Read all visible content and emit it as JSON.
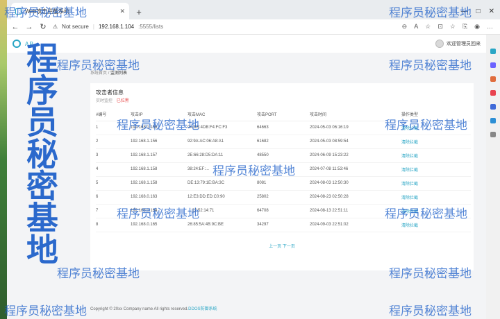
{
  "browser": {
    "tab_title": "Web攻击拦截系统",
    "new_tab": "+",
    "tab_close": "✕",
    "window_controls": [
      "—",
      "□",
      "✕"
    ],
    "nav": {
      "back": "←",
      "forward": "→",
      "reload": "↻"
    },
    "url": {
      "warning": "⚠",
      "not_secure": "Not secure",
      "host": "192.168.1.104",
      "path": ":5555/lists"
    },
    "addr_icons": [
      "⊖",
      "A",
      "☆",
      "⊡",
      "☆",
      "⎘",
      "◉",
      "…"
    ]
  },
  "app": {
    "logo_text": "AP",
    "welcome_text": "欢迎管理员回来"
  },
  "breadcrumb": {
    "home": "系统首页",
    "separator": "/",
    "current": "监测列表"
  },
  "card": {
    "title": "攻击者信息",
    "subtitle": "实时监控",
    "subtitle_flag": "已拉黑"
  },
  "table": {
    "headers": [
      "#编号",
      "攻击IP",
      "攻击MAC",
      "攻击PORT",
      "攻击时间",
      "操作类型"
    ],
    "rows": [
      [
        "1",
        "192.168.1.156",
        "0A:EB:4DB:F4:FC:F3",
        "64663",
        "2024-05-03 06:16:19",
        "清除拦截"
      ],
      [
        "2",
        "192.168.1.156",
        "92:9A:AC:06:A8:A1",
        "61682",
        "2024-05-03 08:59:54",
        "清除拦截"
      ],
      [
        "3",
        "192.168.1.157",
        "2E:66:28:D5:DA:11",
        "48550",
        "2024-06-09 15:23:22",
        "清除拦截"
      ],
      [
        "4",
        "192.168.1.158",
        "38:24:EF:...",
        "",
        "2024-07-08 11:53:46",
        "清除拦截"
      ],
      [
        "5",
        "192.168.1.158",
        "DE:13:79:1E:BA:3C",
        "8081",
        "2024-08-03 12:50:30",
        "清除拦截"
      ],
      [
        "6",
        "192.168.0.163",
        "12:E3:DD:ED:C0:90",
        "25802",
        "2024-08-23 02:50:28",
        "清除拦截"
      ],
      [
        "7",
        "192.168.0.164",
        "...:22:52:14:71",
        "64708",
        "2024-08-13 22:51:11",
        "清除拦截"
      ],
      [
        "8",
        "192.168.0.165",
        "26:85:5A:4B:9C:BE",
        "34297",
        "2024-09-03 22:51:02",
        "清除拦截"
      ]
    ]
  },
  "pager": {
    "prev": "上一页",
    "next": "下一页"
  },
  "footer": {
    "text": "Copyright © 20xx Company name All rights reserved.",
    "link": "DDOS防御系统"
  },
  "watermark": {
    "text": "程序员秘密基地"
  }
}
